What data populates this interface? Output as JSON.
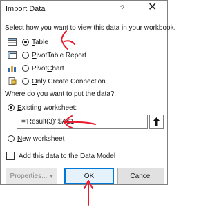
{
  "dialog": {
    "title": "Import Data",
    "help": "?",
    "close": "✕"
  },
  "view_section": {
    "prompt": "Select how you want to view this data in your workbook.",
    "options": [
      {
        "label": "Table",
        "mnemonic": "T",
        "rest": "able",
        "selected": true,
        "icon": "table-icon"
      },
      {
        "label": "PivotTable Report",
        "mnemonic": "P",
        "rest": "ivotTable Report",
        "selected": false,
        "icon": "pivottable-icon"
      },
      {
        "label": "PivotChart",
        "mnemonic": "C",
        "prefix": "Pivot",
        "rest": "hart",
        "selected": false,
        "icon": "pivotchart-icon"
      },
      {
        "label": "Only Create Connection",
        "mnemonic": "O",
        "rest": "nly Create Connection",
        "selected": false,
        "icon": "connection-icon"
      }
    ]
  },
  "location_section": {
    "prompt": "Where do you want to put the data?",
    "existing": {
      "mnemonic": "E",
      "rest": "xisting worksheet:",
      "selected": true
    },
    "range_value": "='Result(3)'!$A$1",
    "new": {
      "mnemonic": "N",
      "rest": "ew worksheet",
      "selected": false
    }
  },
  "data_model": {
    "label": "Add this data to the Data Model",
    "checked": false
  },
  "buttons": {
    "properties": "Properties...",
    "properties_caret": "▾",
    "ok": "OK",
    "cancel": "Cancel"
  },
  "annotation_color": "#e8192c"
}
